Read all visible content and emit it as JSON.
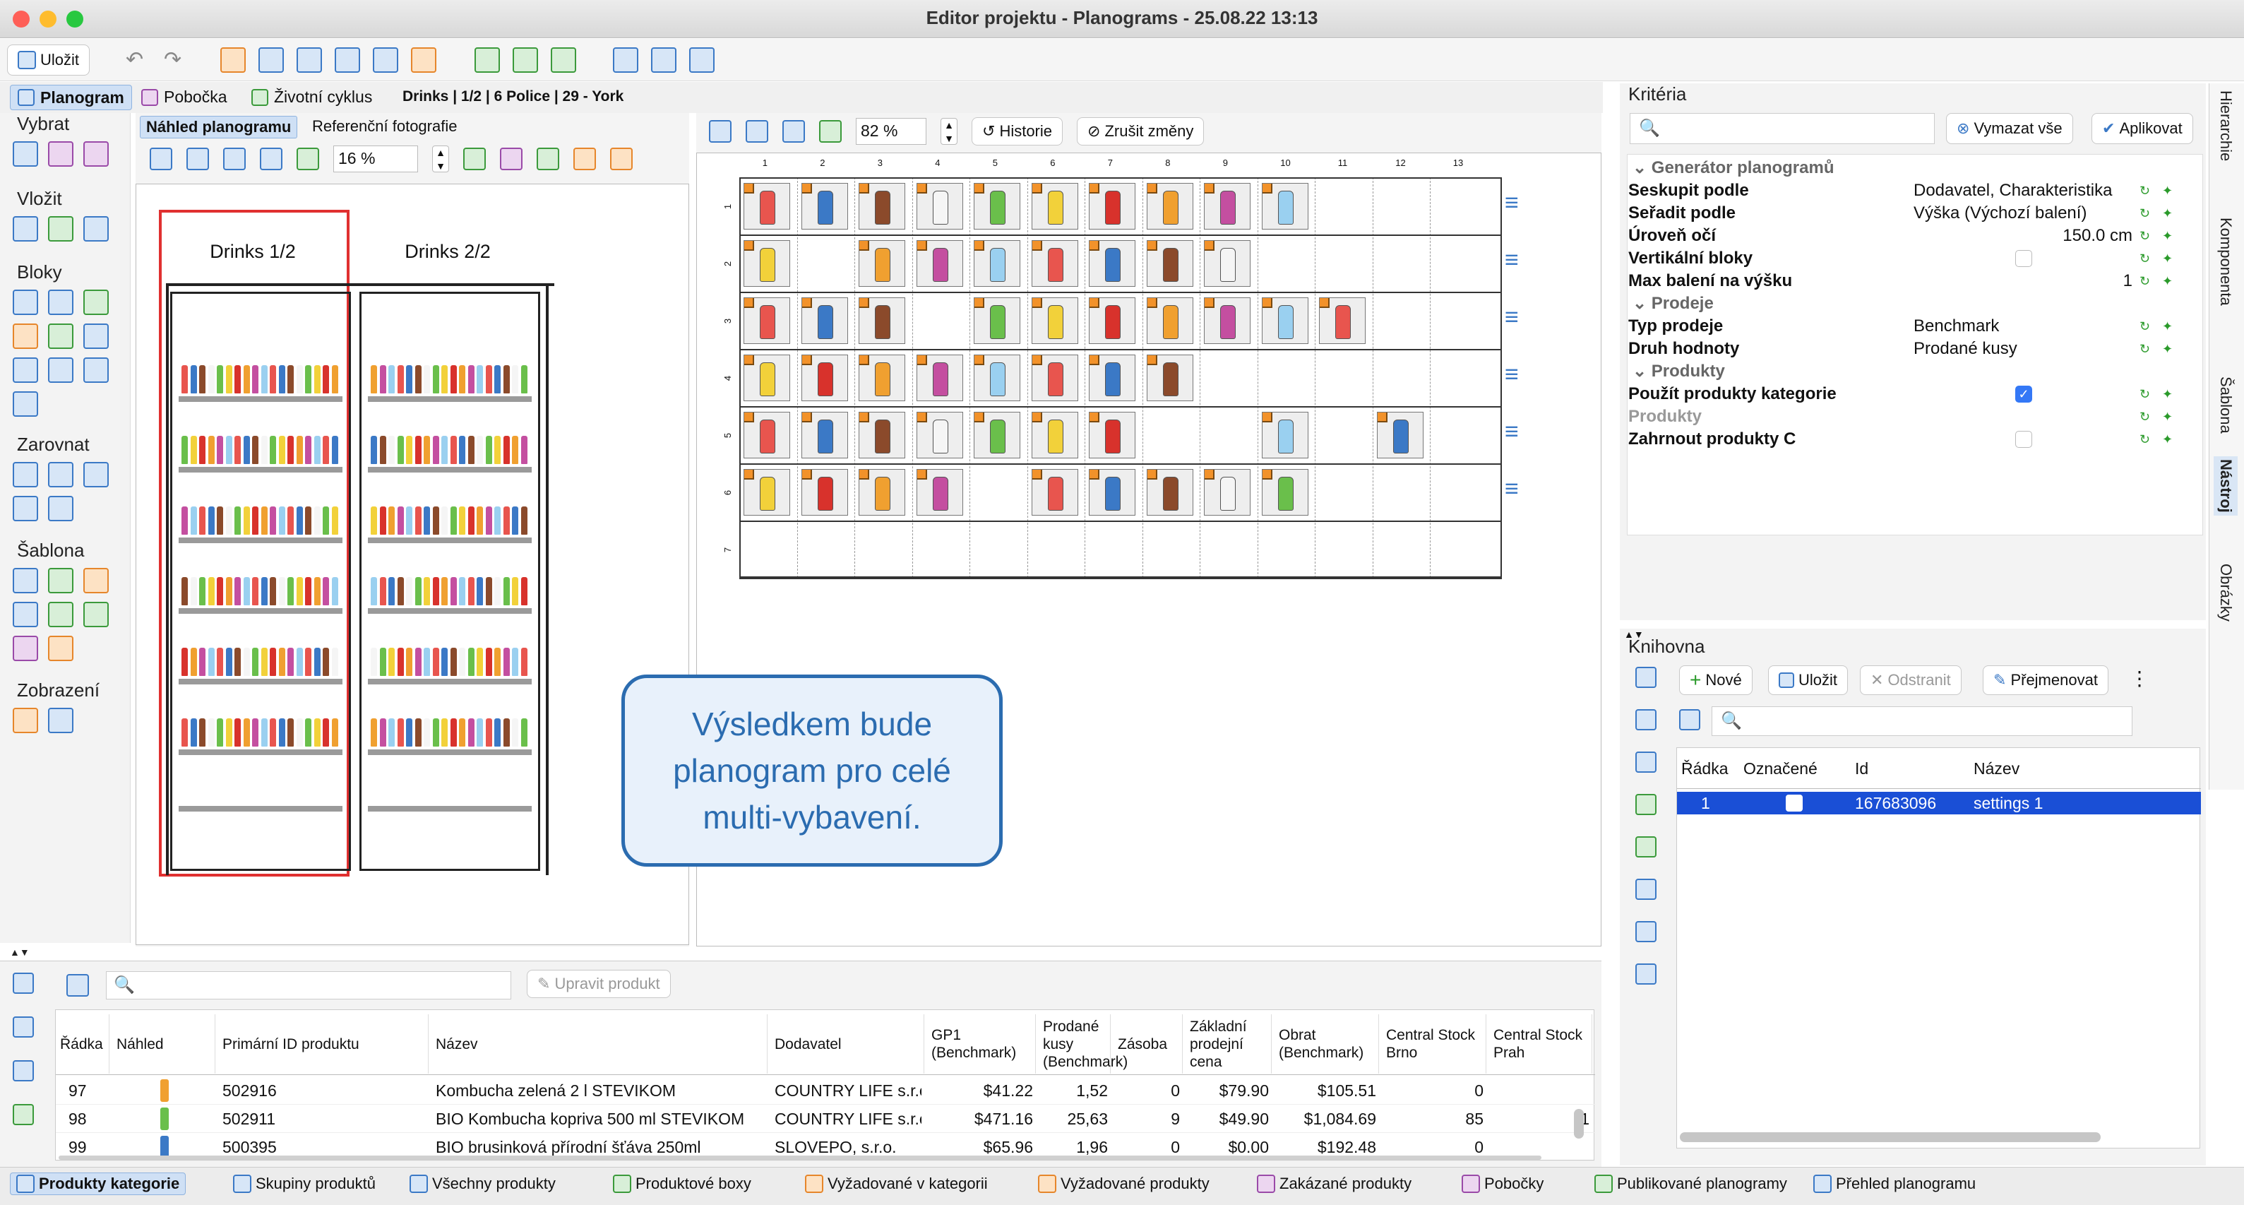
{
  "window": {
    "title": "Editor projektu - Planograms - 25.08.22 13:13"
  },
  "toolbar": {
    "save": "Uložit"
  },
  "nav_tabs": [
    {
      "label": "Planogram"
    },
    {
      "label": "Pobočka"
    },
    {
      "label": "Životní cyklus"
    }
  ],
  "breadcrumb": "Drinks | 1/2 | 6 Police | 29 - York",
  "left_tools": {
    "sections": [
      "Vybrat",
      "Vložit",
      "Bloky",
      "Zarovnat",
      "Šablona",
      "Zobrazení"
    ]
  },
  "preview": {
    "tabs": [
      "Náhled planogramu",
      "Referenční fotografie"
    ],
    "zoom": "16 %",
    "units": [
      {
        "label": "Drinks 1/2"
      },
      {
        "label": "Drinks 2/2"
      }
    ]
  },
  "editor": {
    "zoom": "82 %",
    "history": "Historie",
    "cancel": "Zrušit změny",
    "columns": [
      "1",
      "2",
      "3",
      "4",
      "5",
      "6",
      "7",
      "8",
      "9",
      "10",
      "11",
      "12",
      "13"
    ],
    "rows": [
      "1",
      "2",
      "3",
      "4",
      "5",
      "6",
      "7"
    ]
  },
  "callout": {
    "text": "Výsledkem bude planogram pro celé multi-vybavení."
  },
  "criteria": {
    "title": "Kritéria",
    "clear": "Vymazat vše",
    "apply": "Aplikovat",
    "groups": [
      {
        "name": "Generátor planogramů",
        "rows": [
          {
            "label": "Seskupit podle",
            "value": "Dodavatel, Charakteristika"
          },
          {
            "label": "Seřadit podle",
            "value": "Výška (Výchozí balení)"
          },
          {
            "label": "Úroveň očí",
            "value": "150.0 cm"
          },
          {
            "label": "Vertikální bloky",
            "value": ""
          },
          {
            "label": "Max balení na výšku",
            "value": "1"
          }
        ]
      },
      {
        "name": "Prodeje",
        "rows": [
          {
            "label": "Typ prodeje",
            "value": "Benchmark"
          },
          {
            "label": "Druh hodnoty",
            "value": "Prodané kusy"
          }
        ]
      },
      {
        "name": "Produkty",
        "rows": [
          {
            "label": "Použít produkty kategorie",
            "value": ""
          },
          {
            "label": "Produkty",
            "value": ""
          },
          {
            "label": "Zahrnout produkty C",
            "value": ""
          }
        ]
      }
    ]
  },
  "side_tabs": [
    "Hierarchie",
    "Komponenta",
    "Šablona",
    "Nástroj",
    "Obrázky"
  ],
  "library": {
    "title": "Knihovna",
    "new": "Nové",
    "save": "Uložit",
    "remove": "Odstranit",
    "rename": "Přejmenovat",
    "headers": [
      "Řádka",
      "Označené",
      "Id",
      "Název"
    ],
    "rows": [
      {
        "row": "1",
        "id": "167683096",
        "name": "settings 1"
      }
    ]
  },
  "products": {
    "edit": "Upravit produkt",
    "headers": [
      "Řádka",
      "Náhled",
      "Primární ID produktu",
      "Název",
      "Dodavatel",
      "GP1 (Benchmark)",
      "Prodané kusy (Benchmark)",
      "Zásoba",
      "Základní prodejní cena",
      "Obrat (Benchmark)",
      "Central Stock Brno",
      "Central Stock Prah"
    ],
    "rows": [
      {
        "row": "97",
        "id": "502916",
        "name": "Kombucha zelená 2 l STEVIKOM",
        "supplier": "COUNTRY LIFE s.r.o.",
        "gp1": "$41.22",
        "sold": "1,52",
        "stock": "0",
        "price": "$79.90",
        "turnover": "$105.51",
        "brno": "0",
        "praha": ""
      },
      {
        "row": "98",
        "id": "502911",
        "name": "BIO Kombucha kopriva 500 ml STEVIKOM",
        "supplier": "COUNTRY LIFE s.r.o.",
        "gp1": "$471.16",
        "sold": "25,63",
        "stock": "9",
        "price": "$49.90",
        "turnover": "$1,084.69",
        "brno": "85",
        "praha": "1"
      },
      {
        "row": "99",
        "id": "500395",
        "name": "BIO brusinková přírodní šťáva 250ml",
        "supplier": "SLOVEPO, s.r.o.",
        "gp1": "$65.96",
        "sold": "1,96",
        "stock": "0",
        "price": "$0.00",
        "turnover": "$192.48",
        "brno": "0",
        "praha": ""
      }
    ]
  },
  "bottom_tabs": [
    "Produkty kategorie",
    "Skupiny produktů",
    "Všechny produkty",
    "Produktové boxy",
    "Vyžadované v kategorii",
    "Vyžadované produkty",
    "Zakázané produkty",
    "Pobočky",
    "Publikované planogramy",
    "Přehled planogramu"
  ],
  "colors": {
    "accent": "#1a4fd6",
    "selection": "#1a4fd6",
    "callout": "#2b6cb0",
    "highlight_frame": "#e03030"
  }
}
